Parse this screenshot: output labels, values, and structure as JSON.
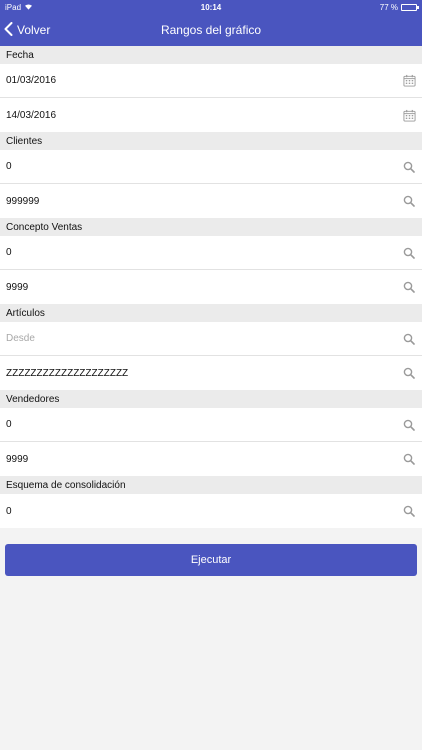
{
  "status_bar": {
    "device": "iPad",
    "time": "10:14",
    "battery_text": "77 %",
    "battery_level": 0.77
  },
  "nav": {
    "back_label": "Volver",
    "title": "Rangos del gráfico"
  },
  "sections": [
    {
      "title": "Fecha",
      "fields": [
        {
          "value": "01/03/2016",
          "placeholder": "",
          "icon": "calendar-icon"
        },
        {
          "value": "14/03/2016",
          "placeholder": "",
          "icon": "calendar-icon"
        }
      ]
    },
    {
      "title": "Clientes",
      "fields": [
        {
          "value": "0",
          "placeholder": "",
          "icon": "search-icon"
        },
        {
          "value": "999999",
          "placeholder": "",
          "icon": "search-icon"
        }
      ]
    },
    {
      "title": "Concepto Ventas",
      "fields": [
        {
          "value": "0",
          "placeholder": "",
          "icon": "search-icon"
        },
        {
          "value": "9999",
          "placeholder": "",
          "icon": "search-icon"
        }
      ]
    },
    {
      "title": "Artículos",
      "fields": [
        {
          "value": "",
          "placeholder": "Desde",
          "icon": "search-icon"
        },
        {
          "value": "ZZZZZZZZZZZZZZZZZZZZ",
          "placeholder": "",
          "icon": "search-icon"
        }
      ]
    },
    {
      "title": "Vendedores",
      "fields": [
        {
          "value": "0",
          "placeholder": "",
          "icon": "search-icon"
        },
        {
          "value": "9999",
          "placeholder": "",
          "icon": "search-icon"
        }
      ]
    },
    {
      "title": "Esquema de consolidación",
      "fields": [
        {
          "value": "0",
          "placeholder": "",
          "icon": "search-icon"
        }
      ]
    }
  ],
  "execute_label": "Ejecutar",
  "colors": {
    "accent": "#4a55bf",
    "section_bg": "#ebebeb",
    "icon": "#9a9a9a"
  }
}
